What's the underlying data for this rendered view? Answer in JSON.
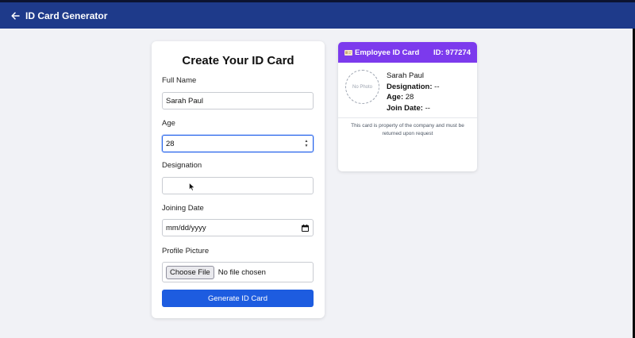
{
  "app": {
    "title": "ID Card Generator"
  },
  "form": {
    "title": "Create Your ID Card",
    "full_name": {
      "label": "Full Name",
      "value": "Sarah Paul"
    },
    "age": {
      "label": "Age",
      "value": "28"
    },
    "designation": {
      "label": "Designation",
      "value": ""
    },
    "joining_date": {
      "label": "Joining Date",
      "placeholder": "mm/dd/yyyy"
    },
    "profile_picture": {
      "label": "Profile Picture",
      "button": "Choose File",
      "status": "No file chosen"
    },
    "submit": "Generate ID Card"
  },
  "card": {
    "header_title": "Employee ID Card",
    "id_text": "ID: 977274",
    "photo_placeholder": "No Photo",
    "name": "Sarah Paul",
    "designation_label": "Designation:",
    "designation_value": "--",
    "age_label": "Age:",
    "age_value": "28",
    "join_label": "Join Date:",
    "join_value": "--",
    "footnote": "This card is property of the company and must be returned upon request"
  },
  "colors": {
    "appbar": "#1e3a8a",
    "card_header": "#7c3aed",
    "primary_button": "#1d5ce0"
  },
  "icons": {
    "back": "arrow-left-icon",
    "calendar": "calendar-icon",
    "id_card": "id-card-icon"
  }
}
